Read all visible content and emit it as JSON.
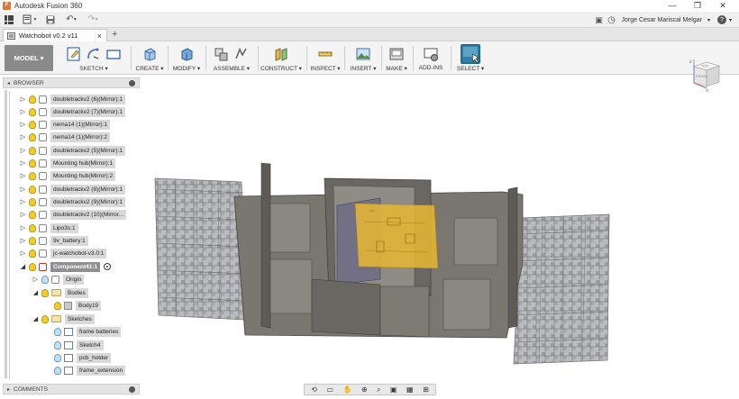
{
  "window": {
    "title": "Autodesk Fusion 360",
    "logo_letter": "F",
    "minimize": "—",
    "restore": "❐",
    "close": "✕"
  },
  "qat": {
    "user_name": "Jorge Cesar Mariscal Melgar",
    "file_arrow": "▾",
    "save_icon": "floppy-icon",
    "undo": "↶",
    "redo": "↷",
    "chat": "▣",
    "history": "◷",
    "help": "?"
  },
  "document": {
    "tab_title": "Watchobot v0.2 v11",
    "tab_close": "×",
    "tab_add": "+"
  },
  "ribbon": {
    "workspace": "MODEL ▾",
    "groups": [
      {
        "label": "SKETCH ▾"
      },
      {
        "label": "CREATE ▾"
      },
      {
        "label": "MODIFY ▾"
      },
      {
        "label": "ASSEMBLE ▾"
      },
      {
        "label": "CONSTRUCT ▾"
      },
      {
        "label": "INSPECT ▾"
      },
      {
        "label": "INSERT ▾"
      },
      {
        "label": "MAKE ▾"
      },
      {
        "label": "ADD-INS"
      },
      {
        "label": "SELECT ▾"
      }
    ]
  },
  "browser": {
    "title": "BROWSER",
    "collapse_arrow": "◂",
    "items": [
      {
        "label": "doubletrackv2 (6)(Mirror):1",
        "expand": "▷"
      },
      {
        "label": "doubletrackv2 (7)(Mirror):1",
        "expand": "▷"
      },
      {
        "label": "nema14 (1)(Mirror):1",
        "expand": "▷"
      },
      {
        "label": "nema14 (1)(Mirror):2",
        "expand": "▷"
      },
      {
        "label": "doubletrackv2 (5)(Mirror):1",
        "expand": "▷"
      },
      {
        "label": "Mounting hub(Mirror):1",
        "expand": "▷"
      },
      {
        "label": "Mounting hub(Mirror):2",
        "expand": "▷"
      },
      {
        "label": "doubletrackv2 (8)(Mirror):1",
        "expand": "▷"
      },
      {
        "label": "doubletrackv2 (9)(Mirror):1",
        "expand": "▷"
      },
      {
        "label": "doubletrackv2 (10)(Mirror...",
        "expand": "▷"
      },
      {
        "label": "Lipo3s:1",
        "expand": "▷"
      },
      {
        "label": "9v_battery:1",
        "expand": "▷"
      },
      {
        "label": "jc-watchobot-v3.0:1",
        "expand": "▷"
      },
      {
        "label": "Component41:1",
        "expand": "◢"
      },
      {
        "label": "Origin",
        "expand": "▷"
      },
      {
        "label": "Bodies",
        "expand": "◢"
      },
      {
        "label": "Body19",
        "expand": ""
      },
      {
        "label": "Sketches",
        "expand": "◢"
      },
      {
        "label": "frame batteries",
        "expand": ""
      },
      {
        "label": "Sketch4",
        "expand": ""
      },
      {
        "label": "pcb_holder",
        "expand": ""
      },
      {
        "label": "frame_extension",
        "expand": ""
      }
    ]
  },
  "comments": {
    "title": "COMMENTS",
    "expand_arrow": "▸"
  },
  "viewcube": {
    "top": "TOP",
    "front": "FRONT",
    "axis_z": "Z",
    "axis_x": "X"
  },
  "colors": {
    "accent": "#e8732a",
    "selected_bg": "#8f8f8f",
    "bulb_yellow": "#f1cc2c",
    "bulb_blue": "#bfe0f5",
    "select_icon": "#2f7fa8",
    "frame_gray": "#6e6a64",
    "pcb_yellow": "#e8b832"
  }
}
